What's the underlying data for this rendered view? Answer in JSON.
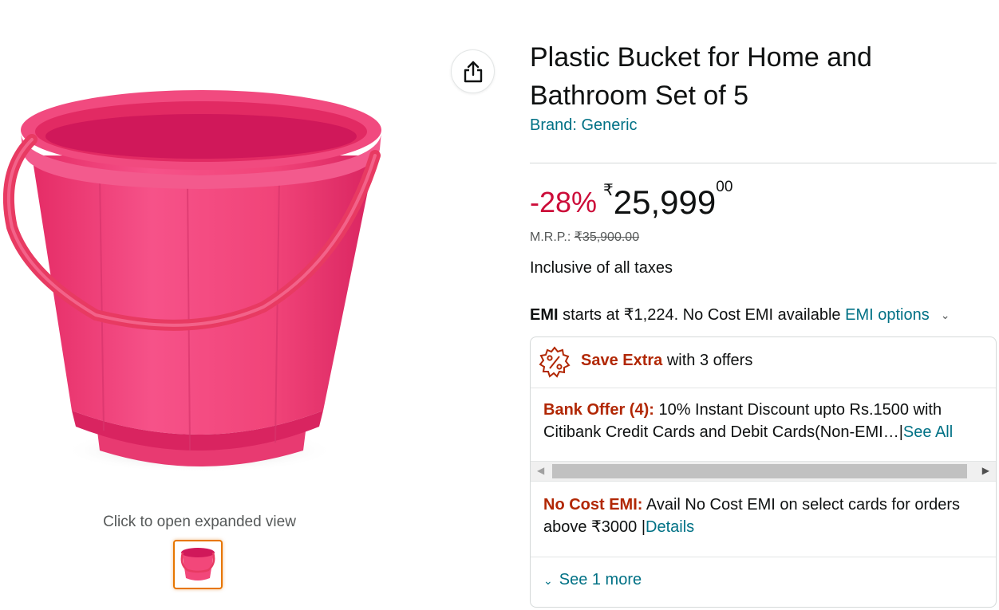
{
  "gallery": {
    "zoom_hint": "Click to open expanded view",
    "product_color": "#f2477a"
  },
  "share": {
    "icon": "share-icon"
  },
  "product": {
    "title": "Plastic Bucket for Home and Bathroom Set of 5",
    "brand": "Brand: Generic"
  },
  "pricing": {
    "discount": "-28%",
    "currency": "₹",
    "price_whole": "25,999",
    "price_fraction": "00",
    "mrp_label": "M.R.P.:",
    "mrp_value": "₹35,900.00",
    "tax_note": "Inclusive of all taxes"
  },
  "emi": {
    "label": "EMI",
    "text": " starts at ₹1,224. No Cost EMI available ",
    "link": "EMI options"
  },
  "offers": {
    "icon": "offer-percent-icon",
    "save_extra": "Save Extra",
    "with_offers": " with 3 offers",
    "bank_offer_label": "Bank Offer (4):",
    "bank_offer_text": " 10% Instant Discount upto Rs.1500 with Citibank Credit Cards and Debit Cards(Non-EMI…",
    "bank_offer_link": "See All",
    "no_cost_emi_label": "No Cost EMI:",
    "no_cost_emi_text": " Avail No Cost EMI on select cards for orders above ₹3000 ",
    "no_cost_emi_link": "Details",
    "see_more": "See 1 more"
  }
}
